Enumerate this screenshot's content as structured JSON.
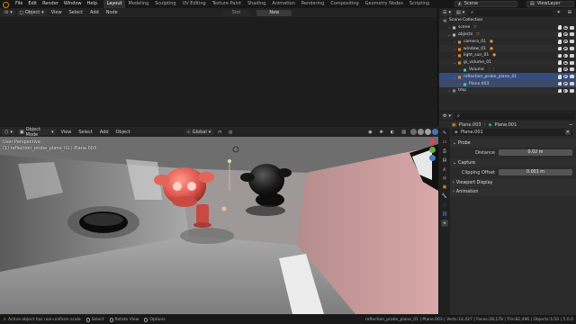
{
  "topbar": {
    "menus": [
      "File",
      "Edit",
      "Render",
      "Window",
      "Help"
    ],
    "workspaces": [
      "Layout",
      "Modeling",
      "Sculpting",
      "UV Editing",
      "Texture Paint",
      "Shading",
      "Animation",
      "Rendering",
      "Compositing",
      "Geometry Nodes",
      "Scripting"
    ],
    "active_workspace": "Layout",
    "scene": "Scene",
    "view_layer": "ViewLayer"
  },
  "upper_editor": {
    "mode": "Object",
    "menus": [
      "View",
      "Select",
      "Add",
      "Node"
    ],
    "slot": "Slot",
    "new_label": "New"
  },
  "viewport": {
    "mode": "Object Mode",
    "menus": [
      "View",
      "Select",
      "Add",
      "Object"
    ],
    "transform": "Global",
    "overlay_title": "User Perspective",
    "overlay_sub": "(1) reflection_probe_plane_01 | Plane.003"
  },
  "outliner": {
    "search_placeholder": "",
    "root": "Scene Collection",
    "rows": [
      {
        "label": "scene",
        "icon_color": "#b5b5b5",
        "extra": "▽"
      },
      {
        "label": "objects",
        "icon_color": "#b5b5b5",
        "extra": "▽"
      },
      {
        "label": "camera_01",
        "icon_color": "#e88a2e",
        "extra": "●"
      },
      {
        "label": "window_01",
        "icon_color": "#e88a2e",
        "extra": "●"
      },
      {
        "label": "light_sun_01",
        "icon_color": "#e88a2e",
        "extra": "●"
      },
      {
        "label": "gi_volume_01",
        "icon_color": "#e88a2e",
        "extra": ""
      },
      {
        "label": "Volume",
        "icon_color": "#4ec9a8",
        "extra": "⋮⋮"
      },
      {
        "label": "reflection_probe_plane_01",
        "icon_color": "#e88a2e",
        "extra": ""
      },
      {
        "label": "Plane.003",
        "icon_color": "#4ec9a8",
        "extra": ""
      },
      {
        "label": "tmp",
        "icon_color": "#8a8a8a",
        "extra": ""
      }
    ]
  },
  "properties": {
    "breadcrumb_object": "Plane.003",
    "breadcrumb_data": "Plane.001",
    "datablock": "Plane.001",
    "panels": {
      "probe": "Probe",
      "distance_label": "Distance",
      "distance_value": "0.02 m",
      "capture": "Capture",
      "clip_label": "Clipping Offset",
      "clip_value": "0.001 m",
      "viewport_display": "Viewport Display",
      "animation": "Animation"
    }
  },
  "statusbar": {
    "warning": "Active object has non-uniform scale",
    "select": "Select",
    "rotate": "Rotate View",
    "options": "Options",
    "stats": "reflection_probe_plane_01 | Plane.003 | Verts:14,427 | Faces:28,178 | Tris:82,496 | Objects:1/10 | 5.0.0"
  },
  "colors": {
    "accent": "#4772b3",
    "selected_row": "#334d80",
    "object_orange": "#e88a2e",
    "data_teal": "#4ec9a8"
  }
}
